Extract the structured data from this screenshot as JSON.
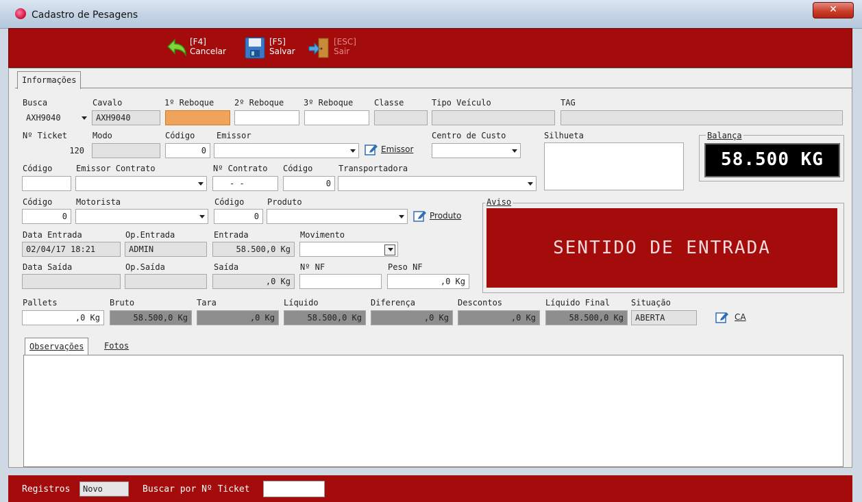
{
  "window": {
    "title": "Cadastro de Pesagens",
    "close_glyph": "✕"
  },
  "toolbar": {
    "cancel": {
      "key": "[F4]",
      "label": "Cancelar",
      "icon": "undo-arrow-icon"
    },
    "save": {
      "key": "[F5]",
      "label": "Salvar",
      "icon": "floppy-disk-icon"
    },
    "exit": {
      "key": "[ESC]",
      "label": "Sair",
      "icon": "exit-door-icon"
    }
  },
  "tabs": {
    "main": "Informações",
    "observacoes": "Observações",
    "fotos": "Fotos"
  },
  "labels": {
    "busca": "Busca",
    "cavalo": "Cavalo",
    "reboque1": "1º Reboque",
    "reboque2": "2º Reboque",
    "reboque3": "3º Reboque",
    "classe": "Classe",
    "tipo_veiculo": "Tipo Veículo",
    "tag": "TAG",
    "ticket": "Nº Ticket",
    "modo": "Modo",
    "codigo": "Código",
    "emissor": "Emissor",
    "centro_custo": "Centro de Custo",
    "silhueta": "Silhueta",
    "balanca": "Balança",
    "emissor_contrato": "Emissor Contrato",
    "num_contrato": "Nº Contrato",
    "transportadora": "Transportadora",
    "motorista": "Motorista",
    "produto": "Produto",
    "aviso": "Aviso",
    "data_entrada": "Data Entrada",
    "op_entrada": "Op.Entrada",
    "entrada": "Entrada",
    "movimento": "Movimento",
    "data_saida": "Data Saída",
    "op_saida": "Op.Saída",
    "saida": "Saída",
    "num_nf": "Nº NF",
    "peso_nf": "Peso NF",
    "pallets": "Pallets",
    "bruto": "Bruto",
    "tara": "Tara",
    "liquido": "Líquido",
    "diferenca": "Diferença",
    "descontos": "Descontos",
    "liquido_final": "Líquido Final",
    "situacao": "Situação"
  },
  "values": {
    "busca": "AXH9040",
    "cavalo": "AXH9040",
    "reboque1": "",
    "reboque2": "",
    "reboque3": "",
    "classe": "",
    "tipo_veiculo": "",
    "tag": "",
    "ticket": "120",
    "modo": "",
    "codigo_emissor": "0",
    "emissor": "",
    "centro_custo": "",
    "codigo_emissor_contrato": "",
    "emissor_contrato": "",
    "num_contrato": "-  -",
    "codigo_transportadora": "0",
    "transportadora": "",
    "codigo_motorista": "0",
    "motorista": "",
    "codigo_produto": "0",
    "produto": "",
    "data_entrada": "02/04/17 18:21",
    "op_entrada": "ADMIN",
    "entrada": "58.500,0 Kg",
    "movimento": "",
    "data_saida": "",
    "op_saida": "",
    "saida": ",0 Kg",
    "num_nf": "",
    "peso_nf": ",0 Kg",
    "pallets": ",0 Kg",
    "bruto": "58.500,0 Kg",
    "tara": ",0 Kg",
    "liquido": "58.500,0 Kg",
    "diferenca": ",0 Kg",
    "descontos": ",0 Kg",
    "liquido_final": "58.500,0 Kg",
    "situacao": "ABERTA",
    "observacoes": ""
  },
  "balanca_display": "58.500 KG",
  "aviso_text": "SENTIDO DE ENTRADA",
  "buttons": {
    "emissor": "Emissor",
    "produto": "Produto",
    "ca": "CA"
  },
  "statusbar": {
    "registros_label": "Registros",
    "registros_value": "Novo",
    "buscar_label": "Buscar por Nº Ticket",
    "buscar_value": ""
  },
  "colors": {
    "brand_red": "#a40c0c",
    "active_field": "#f0a35a"
  }
}
